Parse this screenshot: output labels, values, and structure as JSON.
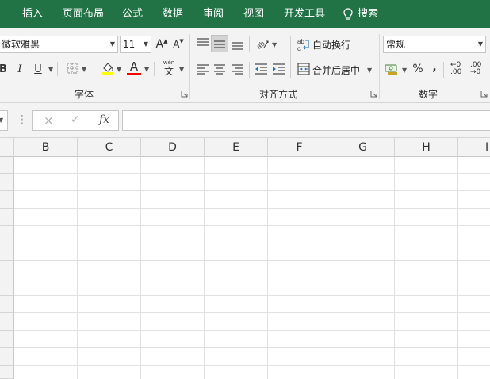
{
  "ribbon_tabs": [
    "插入",
    "页面布局",
    "公式",
    "数据",
    "审阅",
    "视图",
    "开发工具"
  ],
  "tell_me": {
    "label": "搜索",
    "icon": "lightbulb-icon"
  },
  "font_group": {
    "font_name": "微软雅黑",
    "font_size": "11",
    "increase_font_label": "A",
    "decrease_font_label": "A",
    "bold_label": "B",
    "italic_label": "I",
    "underline_label": "U",
    "font_color_label": "A",
    "phonetic_label": "wén",
    "phonetic_char": "文",
    "group_label": "字体",
    "highlight_color": "#ffff00",
    "font_color": "#ff0000"
  },
  "alignment_group": {
    "wrap_text_label": "自动换行",
    "merge_center_label": "合并后居中",
    "group_label": "对齐方式"
  },
  "number_group": {
    "format_value": "常规",
    "percent_label": "%",
    "comma_label": ",",
    "increase_decimal_top": "←0",
    "increase_decimal_bottom": ".00",
    "decrease_decimal_top": ".00",
    "decrease_decimal_bottom": "→0",
    "group_label": "数字"
  },
  "formula_bar": {
    "fx_label": "fx",
    "cancel_label": "×",
    "enter_label": "✓",
    "formula_value": ""
  },
  "grid": {
    "columns": [
      "B",
      "C",
      "D",
      "E",
      "F",
      "G",
      "H",
      "I"
    ]
  },
  "colors": {
    "accent": "#217346",
    "ribbon_bg": "#f3f3f3"
  }
}
